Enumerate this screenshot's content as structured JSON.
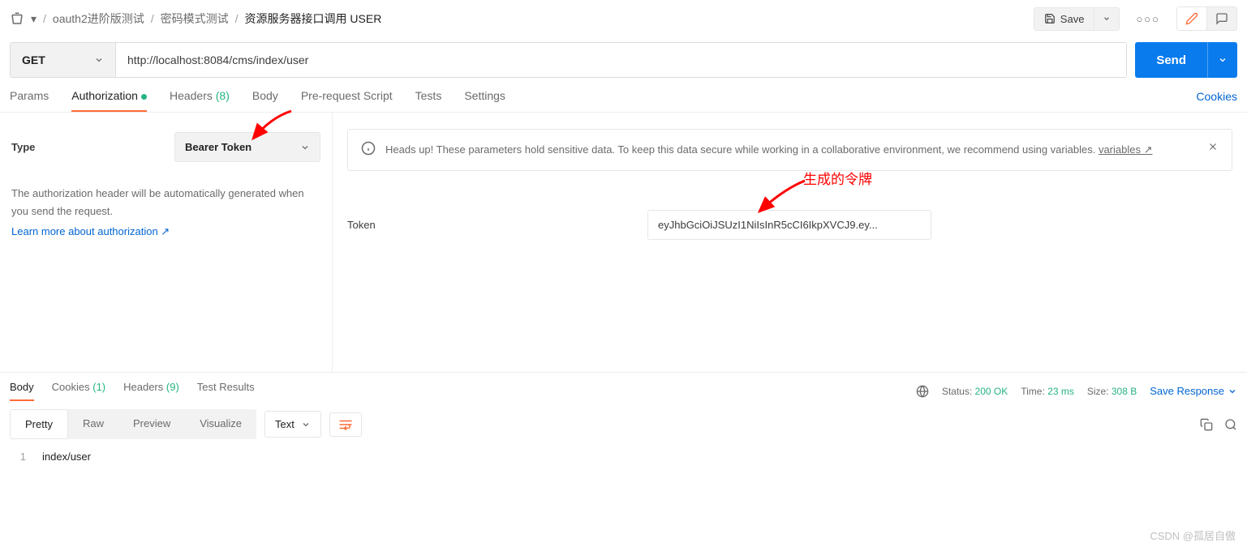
{
  "breadcrumb": {
    "item1": "oauth2进阶版测试",
    "item2": "密码模式测试",
    "item3": "资源服务器接口调用 USER"
  },
  "topbar": {
    "save": "Save"
  },
  "request": {
    "method": "GET",
    "url": "http://localhost:8084/cms/index/user",
    "send": "Send"
  },
  "reqTabs": {
    "params": "Params",
    "auth": "Authorization",
    "headers": "Headers",
    "headersCount": "(8)",
    "body": "Body",
    "prescript": "Pre-request Script",
    "tests": "Tests",
    "settings": "Settings",
    "cookies": "Cookies"
  },
  "auth": {
    "typeLabel": "Type",
    "typeValue": "Bearer Token",
    "desc": "The authorization header will be automatically generated when you send the request.",
    "learnMore": "Learn more about authorization ↗",
    "alert": "Heads up! These parameters hold sensitive data. To keep this data secure while working in a collaborative environment, we recommend using variables.",
    "alertLink": "variables ↗",
    "tokenLabel": "Token",
    "tokenValue": "eyJhbGciOiJSUzI1NiIsInR5cCI6IkpXVCJ9.ey..."
  },
  "annotations": {
    "token": "生成的令牌"
  },
  "respTabs": {
    "body": "Body",
    "cookies": "Cookies",
    "cookiesCount": "(1)",
    "headers": "Headers",
    "headersCount": "(9)",
    "tests": "Test Results"
  },
  "respMeta": {
    "statusLabel": "Status:",
    "statusValue": "200 OK",
    "timeLabel": "Time:",
    "timeValue": "23 ms",
    "sizeLabel": "Size:",
    "sizeValue": "308 B",
    "saveResp": "Save Response"
  },
  "bodyView": {
    "pretty": "Pretty",
    "raw": "Raw",
    "preview": "Preview",
    "visualize": "Visualize",
    "format": "Text"
  },
  "code": {
    "line1No": "1",
    "line1": "index/user"
  },
  "watermark": "CSDN @孤居自傲"
}
